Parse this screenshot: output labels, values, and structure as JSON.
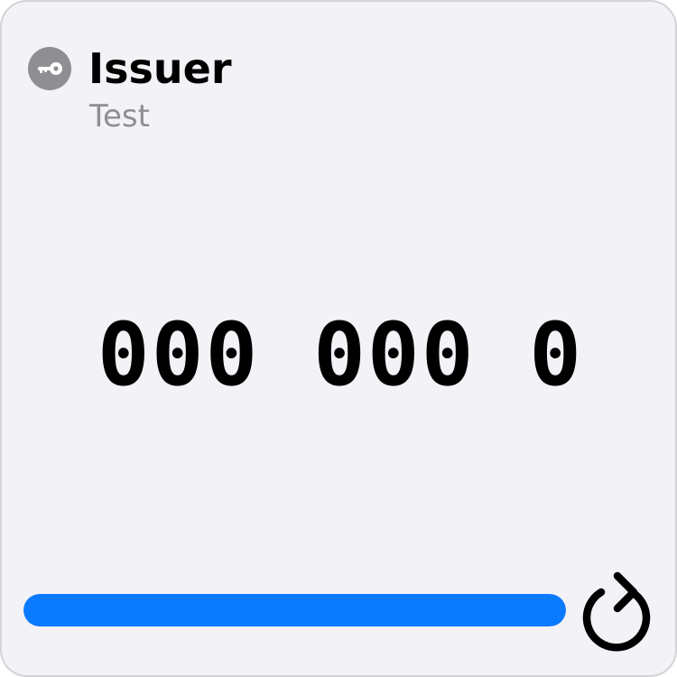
{
  "issuer": {
    "name": "Issuer",
    "icon": "key-icon"
  },
  "account": {
    "name": "Test"
  },
  "code": {
    "display": "000 000 0"
  },
  "progress": {
    "fraction": 1.0
  },
  "refresh": {
    "icon": "refresh-icon"
  },
  "colors": {
    "background": "#f2f2f7",
    "accent": "#0a7aff",
    "icon_bg": "#8e8e93",
    "secondary_text": "#8e8e93"
  }
}
